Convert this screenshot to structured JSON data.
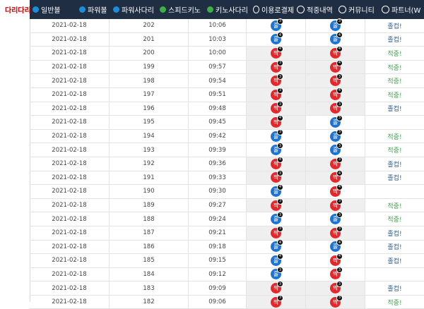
{
  "nav": [
    {
      "label": "다리다리",
      "icon": "ladder-icon",
      "active": true,
      "color": "#d8272c"
    },
    {
      "label": "일반볼",
      "icon": "ball-icon",
      "active": false,
      "color": "#1a8fd8"
    },
    {
      "label": "파워볼",
      "icon": "powerball-icon",
      "active": false,
      "color": "#1a8fd8"
    },
    {
      "label": "파워사다리",
      "icon": "power-ladder-icon",
      "active": false,
      "color": "#1a8fd8"
    },
    {
      "label": "스피드키노",
      "icon": "speedkeno-icon",
      "active": false,
      "color": "#3cb043"
    },
    {
      "label": "키노사다리",
      "icon": "keno-ladder-icon",
      "active": false,
      "color": "#3cb043"
    },
    {
      "label": "이용로결제",
      "icon": "payment-icon",
      "active": false,
      "color": "#ffffff"
    },
    {
      "label": "적중내역",
      "icon": "checklist-icon",
      "active": false,
      "color": "#ffffff"
    },
    {
      "label": "커뮤니티",
      "icon": "community-icon",
      "active": false,
      "color": "#ffffff"
    },
    {
      "label": "파트너(W",
      "icon": "partner-icon",
      "active": false,
      "color": "#ffffff"
    }
  ],
  "rows": [
    {
      "date": "2021-02-18",
      "round": "202",
      "time": "10:06",
      "result": {
        "text": "홀",
        "color": "blue",
        "badge": "3"
      },
      "pick": {
        "text": "홀",
        "color": "blue",
        "badge": "3"
      },
      "hit": "졸컵!"
    },
    {
      "date": "2021-02-18",
      "round": "201",
      "time": "10:03",
      "result": {
        "text": "홀",
        "color": "blue",
        "badge": "4"
      },
      "pick": {
        "text": "홀",
        "color": "blue",
        "badge": "4"
      },
      "hit": "졸컵!"
    },
    {
      "date": "2021-02-18",
      "round": "200",
      "time": "10:00",
      "result": {
        "text": "짝",
        "color": "red",
        "badge": "4"
      },
      "pick": {
        "text": "짝",
        "color": "red",
        "badge": "4"
      },
      "hit": "적중!"
    },
    {
      "date": "2021-02-18",
      "round": "199",
      "time": "09:57",
      "result": {
        "text": "짝",
        "color": "red",
        "badge": "3"
      },
      "pick": {
        "text": "짝",
        "color": "red",
        "badge": "4"
      },
      "hit": "적중!"
    },
    {
      "date": "2021-02-18",
      "round": "198",
      "time": "09:54",
      "result": {
        "text": "짝",
        "color": "red",
        "badge": "3"
      },
      "pick": {
        "text": "짝",
        "color": "red",
        "badge": "3"
      },
      "hit": "적중!"
    },
    {
      "date": "2021-02-18",
      "round": "197",
      "time": "09:51",
      "result": {
        "text": "짝",
        "color": "red",
        "badge": "3"
      },
      "pick": {
        "text": "짝",
        "color": "red",
        "badge": "4"
      },
      "hit": "적중!"
    },
    {
      "date": "2021-02-18",
      "round": "196",
      "time": "09:48",
      "result": {
        "text": "짝",
        "color": "red",
        "badge": "3"
      },
      "pick": {
        "text": "짝",
        "color": "red",
        "badge": "3"
      },
      "hit": "졸컵!"
    },
    {
      "date": "2021-02-18",
      "round": "195",
      "time": "09:45",
      "result": {
        "text": "짝",
        "color": "red",
        "badge": "4"
      },
      "pick": {
        "text": "홀",
        "color": "blue",
        "badge": "3"
      },
      "hit": ""
    },
    {
      "date": "2021-02-18",
      "round": "194",
      "time": "09:42",
      "result": {
        "text": "홀",
        "color": "blue",
        "badge": "3"
      },
      "pick": {
        "text": "홀",
        "color": "blue",
        "badge": "3"
      },
      "hit": "적중!"
    },
    {
      "date": "2021-02-18",
      "round": "193",
      "time": "09:39",
      "result": {
        "text": "홀",
        "color": "blue",
        "badge": "3"
      },
      "pick": {
        "text": "홀",
        "color": "blue",
        "badge": "3"
      },
      "hit": "적중!"
    },
    {
      "date": "2021-02-18",
      "round": "192",
      "time": "09:36",
      "result": {
        "text": "짝",
        "color": "red",
        "badge": "4"
      },
      "pick": {
        "text": "짝",
        "color": "red",
        "badge": "3"
      },
      "hit": "졸컵!"
    },
    {
      "date": "2021-02-18",
      "round": "191",
      "time": "09:33",
      "result": {
        "text": "짝",
        "color": "red",
        "badge": "3"
      },
      "pick": {
        "text": "짝",
        "color": "red",
        "badge": "4"
      },
      "hit": "졸컵!"
    },
    {
      "date": "2021-02-18",
      "round": "190",
      "time": "09:30",
      "result": {
        "text": "홀",
        "color": "blue",
        "badge": "4"
      },
      "pick": {
        "text": "짝",
        "color": "red",
        "badge": "4"
      },
      "hit": ""
    },
    {
      "date": "2021-02-18",
      "round": "189",
      "time": "09:27",
      "result": {
        "text": "짝",
        "color": "red",
        "badge": "3"
      },
      "pick": {
        "text": "짝",
        "color": "red",
        "badge": "3"
      },
      "hit": "적중!"
    },
    {
      "date": "2021-02-18",
      "round": "188",
      "time": "09:24",
      "result": {
        "text": "홀",
        "color": "blue",
        "badge": "3"
      },
      "pick": {
        "text": "홀",
        "color": "blue",
        "badge": "3"
      },
      "hit": "적중!"
    },
    {
      "date": "2021-02-18",
      "round": "187",
      "time": "09:21",
      "result": {
        "text": "짝",
        "color": "red",
        "badge": "3"
      },
      "pick": {
        "text": "짝",
        "color": "red",
        "badge": "3"
      },
      "hit": "졸컵!"
    },
    {
      "date": "2021-02-18",
      "round": "186",
      "time": "09:18",
      "result": {
        "text": "홀",
        "color": "blue",
        "badge": "4"
      },
      "pick": {
        "text": "홀",
        "color": "blue",
        "badge": "4"
      },
      "hit": "졸컵!"
    },
    {
      "date": "2021-02-18",
      "round": "185",
      "time": "09:15",
      "result": {
        "text": "홀",
        "color": "blue",
        "badge": "4"
      },
      "pick": {
        "text": "짝",
        "color": "red",
        "badge": "4"
      },
      "hit": "졸컵!"
    },
    {
      "date": "2021-02-18",
      "round": "184",
      "time": "09:12",
      "result": {
        "text": "홀",
        "color": "blue",
        "badge": "3"
      },
      "pick": {
        "text": "짝",
        "color": "red",
        "badge": "3"
      },
      "hit": ""
    },
    {
      "date": "2021-02-18",
      "round": "183",
      "time": "09:09",
      "result": {
        "text": "짝",
        "color": "red",
        "badge": "3"
      },
      "pick": {
        "text": "짝",
        "color": "red",
        "badge": "3"
      },
      "hit": "졸컵!"
    },
    {
      "date": "2021-02-18",
      "round": "182",
      "time": "09:06",
      "result": {
        "text": "짝",
        "color": "red",
        "badge": "3"
      },
      "pick": {
        "text": "짝",
        "color": "red",
        "badge": "3"
      },
      "hit": "적중!"
    }
  ]
}
